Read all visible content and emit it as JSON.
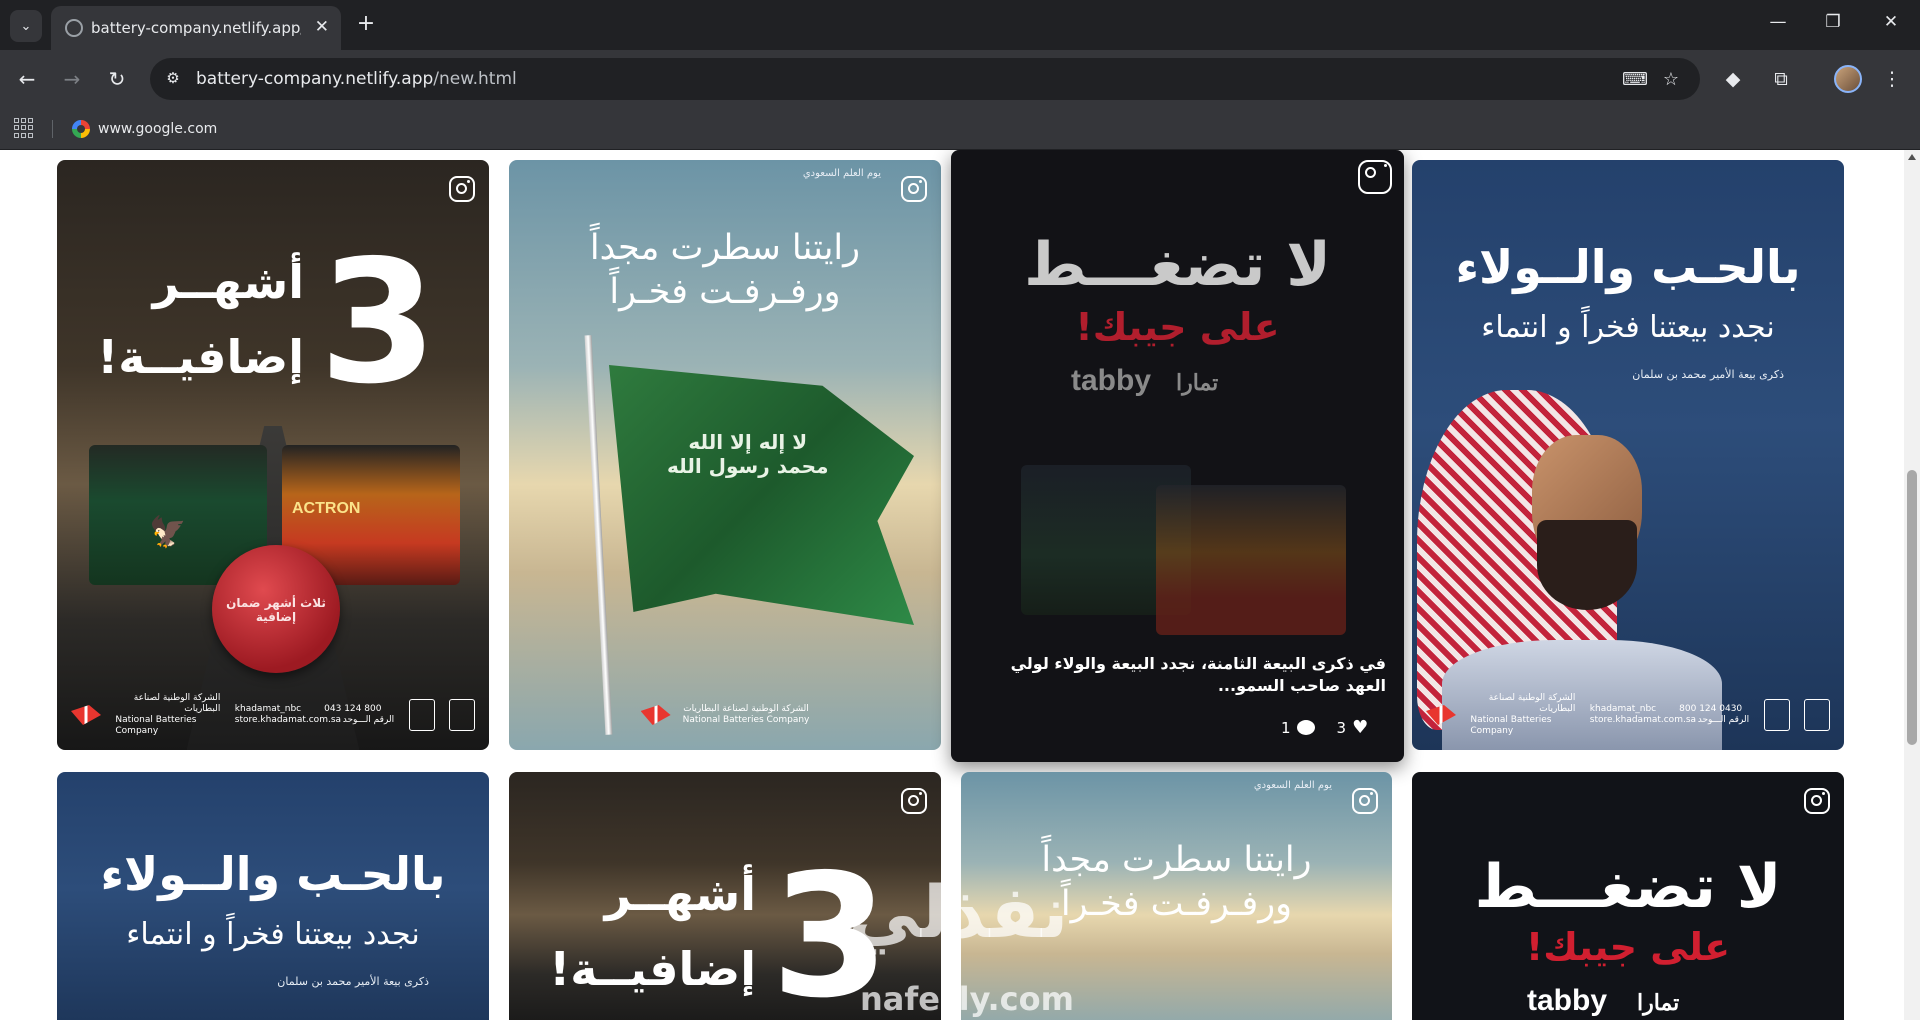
{
  "browser": {
    "tab_title": "battery-company.netlify.app/ne",
    "url_host": "battery-company.netlify.app",
    "url_path": "/new.html",
    "bookmark_label": "www.google.com"
  },
  "posts": [
    {
      "kind": "three-months",
      "big_number": "3",
      "headline_1": "أشهــر",
      "headline_2": "إضافيــة!",
      "seal_text": "ثلاث أشهر ضمان إضافية",
      "battery_brand": "ACTRON",
      "footer_company_ar": "الشركة الوطنية لصناعة البطاريات",
      "footer_company_en": "National Batteries Company",
      "footer_handle": "khadamat_nbc",
      "footer_site": "store.khadamat.com.sa",
      "footer_phone": "043 124 800",
      "footer_unified": "الرقم الـــوحد"
    },
    {
      "kind": "flag",
      "top_tag": "يوم العلم السعودي",
      "headline_1": "رايتنا سطرت مجداً",
      "headline_2": "ورفـرفـت فخـراً",
      "flag_text": "لا إله إلا الله محمد رسول الله",
      "footer_company_ar": "الشركة الوطنية لصناعة البطاريات",
      "footer_company_en": "National Batteries Company"
    },
    {
      "kind": "tabby",
      "headline_1": "لا تضغـــط",
      "headline_2": "على جيبك!",
      "tabby_brand": "tabby",
      "tamara_brand": "تمارا",
      "caption": "في ذكرى البيعة الثامنة، نجدد البيعة والولاء لولي العهد صاحب السمو...",
      "likes": "3",
      "comments": "1"
    },
    {
      "kind": "prince",
      "headline_1": "بالحـب والــولاء",
      "headline_2": "نجدد بيعتنا فخراً و انتماء",
      "subline": "ذكرى بيعة الأمير محمد بن سلمان",
      "footer_company_ar": "الشركة الوطنية لصناعة البطاريات",
      "footer_company_en": "National Batteries Company",
      "footer_handle": "khadamat_nbc",
      "footer_site": "store.khadamat.com.sa",
      "footer_phone": "800 124 0430",
      "footer_unified": "الرقم الـــوحد"
    }
  ],
  "row2": [
    {
      "headline_1": "بالحـب والــولاء",
      "headline_2": "نجدد بيعتنا فخراً و انتماء",
      "subline": "ذكرى بيعة الأمير محمد بن سلمان"
    },
    {
      "big_number": "3",
      "headline_1": "أشهــر",
      "headline_2": "إضافيــة!"
    },
    {
      "top_tag": "يوم العلم السعودي",
      "headline_1": "رايتنا سطرت مجداً",
      "headline_2": "ورفـرفـت فخـراً"
    },
    {
      "headline_1": "لا تضغـــط",
      "headline_2": "على جيبك!",
      "tabby_brand": "tabby",
      "tamara_brand": "تمارا"
    }
  ],
  "watermark": {
    "ar": "نفذلي",
    "en": "nafezly.com"
  },
  "colors": {
    "chrome_dark": "#202124",
    "chrome_mid": "#35363a",
    "accent_red": "#e8362f",
    "flag_green": "#2f7b3e"
  }
}
